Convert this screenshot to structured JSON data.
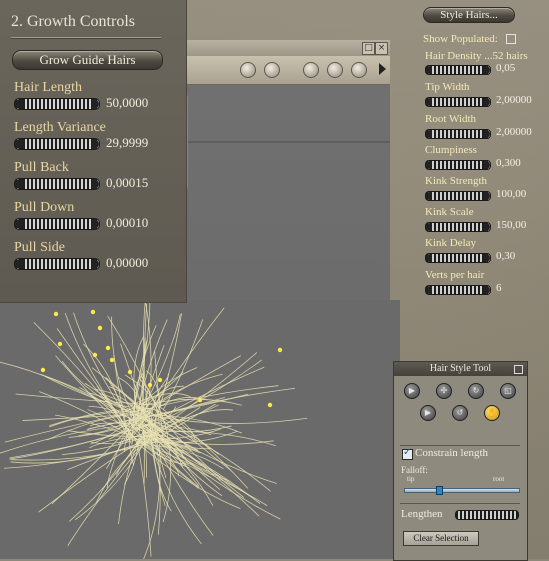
{
  "growth_panel": {
    "title": "2. Growth Controls",
    "grow_button": "Grow Guide Hairs",
    "params": [
      {
        "label": "Hair Length",
        "value": "50,0000"
      },
      {
        "label": "Length Variance",
        "value": "29,9999"
      },
      {
        "label": "Pull Back",
        "value": "0,00015"
      },
      {
        "label": "Pull Down",
        "value": "0,00010"
      },
      {
        "label": "Pull Side",
        "value": "0,00000"
      }
    ]
  },
  "style_panel": {
    "style_button": "Style Hairs...",
    "show_populated_label": "Show Populated:",
    "show_populated_checked": false,
    "params": [
      {
        "label": "Hair Density ...52 hairs",
        "value": "0,05"
      },
      {
        "label": "Tip Width",
        "value": "2,00000"
      },
      {
        "label": "Root Width",
        "value": "2,00000"
      },
      {
        "label": "Clumpiness",
        "value": "0,300"
      },
      {
        "label": "Kink Strength",
        "value": "100,00"
      },
      {
        "label": "Kink Scale",
        "value": "150,00"
      },
      {
        "label": "Kink Delay",
        "value": "0,30"
      },
      {
        "label": "Verts per hair",
        "value": "6"
      }
    ]
  },
  "hair_style_tool": {
    "title": "Hair Style Tool",
    "constrain_label": "Constrain length",
    "constrain_checked": true,
    "falloff_label": "Falloff:",
    "tip_label": "tip",
    "root_label": "root",
    "falloff_fraction": 0.3,
    "lengthen_label": "Lengthen",
    "clear_button": "Clear Selection"
  },
  "viewport": {
    "toolbar_icons": [
      "camera-icon",
      "folder-camera-icon",
      "rotate-icon",
      "move-icon",
      "figure-icon",
      "arrow-right-icon"
    ]
  },
  "colors": {
    "panel_bg": "#5e5a51",
    "label_gold": "#e8d7a0",
    "hair_strand": "#e9e2b2",
    "guide_tip": "#ffe94a",
    "active_tool": "#ffd040"
  }
}
